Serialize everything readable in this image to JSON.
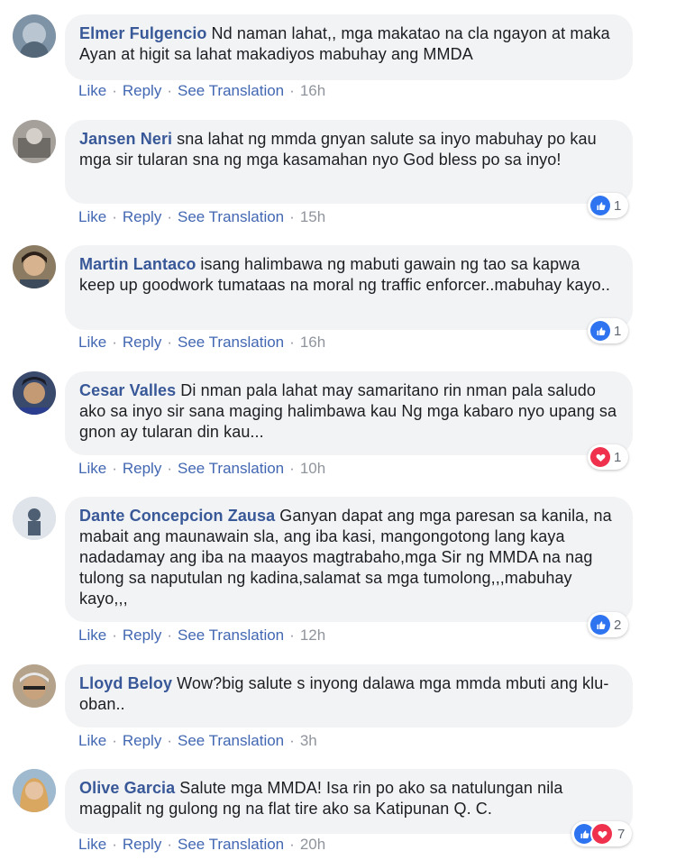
{
  "actions": {
    "like": "Like",
    "reply": "Reply",
    "translate": "See Translation",
    "separator": "·"
  },
  "comments": [
    {
      "author": "Elmer Fulgencio",
      "text": "Nd naman lahat,, mga makatao na cla ngayon at maka Ayan at higit sa lahat makadiyos mabuhay ang MMDA",
      "time": "16h",
      "reactions": null
    },
    {
      "author": "Jansen Neri",
      "text": "sna lahat ng mmda gnyan salute sa inyo mabuhay po kau mga sir tularan sna ng mga kasamahan nyo God bless po sa inyo!",
      "time": "15h",
      "reactions": {
        "count": "1",
        "icons": [
          "like-icon"
        ]
      }
    },
    {
      "author": "Martin Lantaco",
      "text": "isang halimbawa ng mabuti gawain ng tao sa kapwa keep up goodwork tumataas na moral ng traffic enforcer..mabuhay kayo..",
      "time": "16h",
      "reactions": {
        "count": "1",
        "icons": [
          "like-icon"
        ]
      }
    },
    {
      "author": "Cesar Valles",
      "text": "Di nman pala lahat may samaritano rin nman pala saludo ako sa inyo sir sana maging halimbawa kau Ng mga kabaro nyo upang sa gnon ay tularan din kau...",
      "time": "10h",
      "reactions": {
        "count": "1",
        "icons": [
          "love-icon"
        ]
      }
    },
    {
      "author": "Dante Concepcion Zausa",
      "text": "Ganyan dapat ang mga paresan sa kanila, na mabait ang maunawain sla, ang iba kasi, mangongotong lang kaya nadadamay ang iba na maayos magtrabaho,mga Sir ng MMDA na nag tulong sa naputulan ng kadina,salamat sa mga tumolong,,,mabuhay kayo,,,",
      "time": "12h",
      "reactions": {
        "count": "2",
        "icons": [
          "like-icon"
        ]
      }
    },
    {
      "author": "Lloyd Beloy",
      "text": "Wow?big salute s inyong dalawa mga mmda mbuti ang klu-oban..",
      "time": "3h",
      "reactions": null
    },
    {
      "author": "Olive Garcia",
      "text": "Salute mga MMDA! Isa rin po ako sa natulungan nila magpalit ng gulong ng na flat tire ako sa Katipunan Q. C.",
      "time": "20h",
      "reactions": {
        "count": "7",
        "icons": [
          "like-icon",
          "love-icon"
        ]
      }
    }
  ]
}
